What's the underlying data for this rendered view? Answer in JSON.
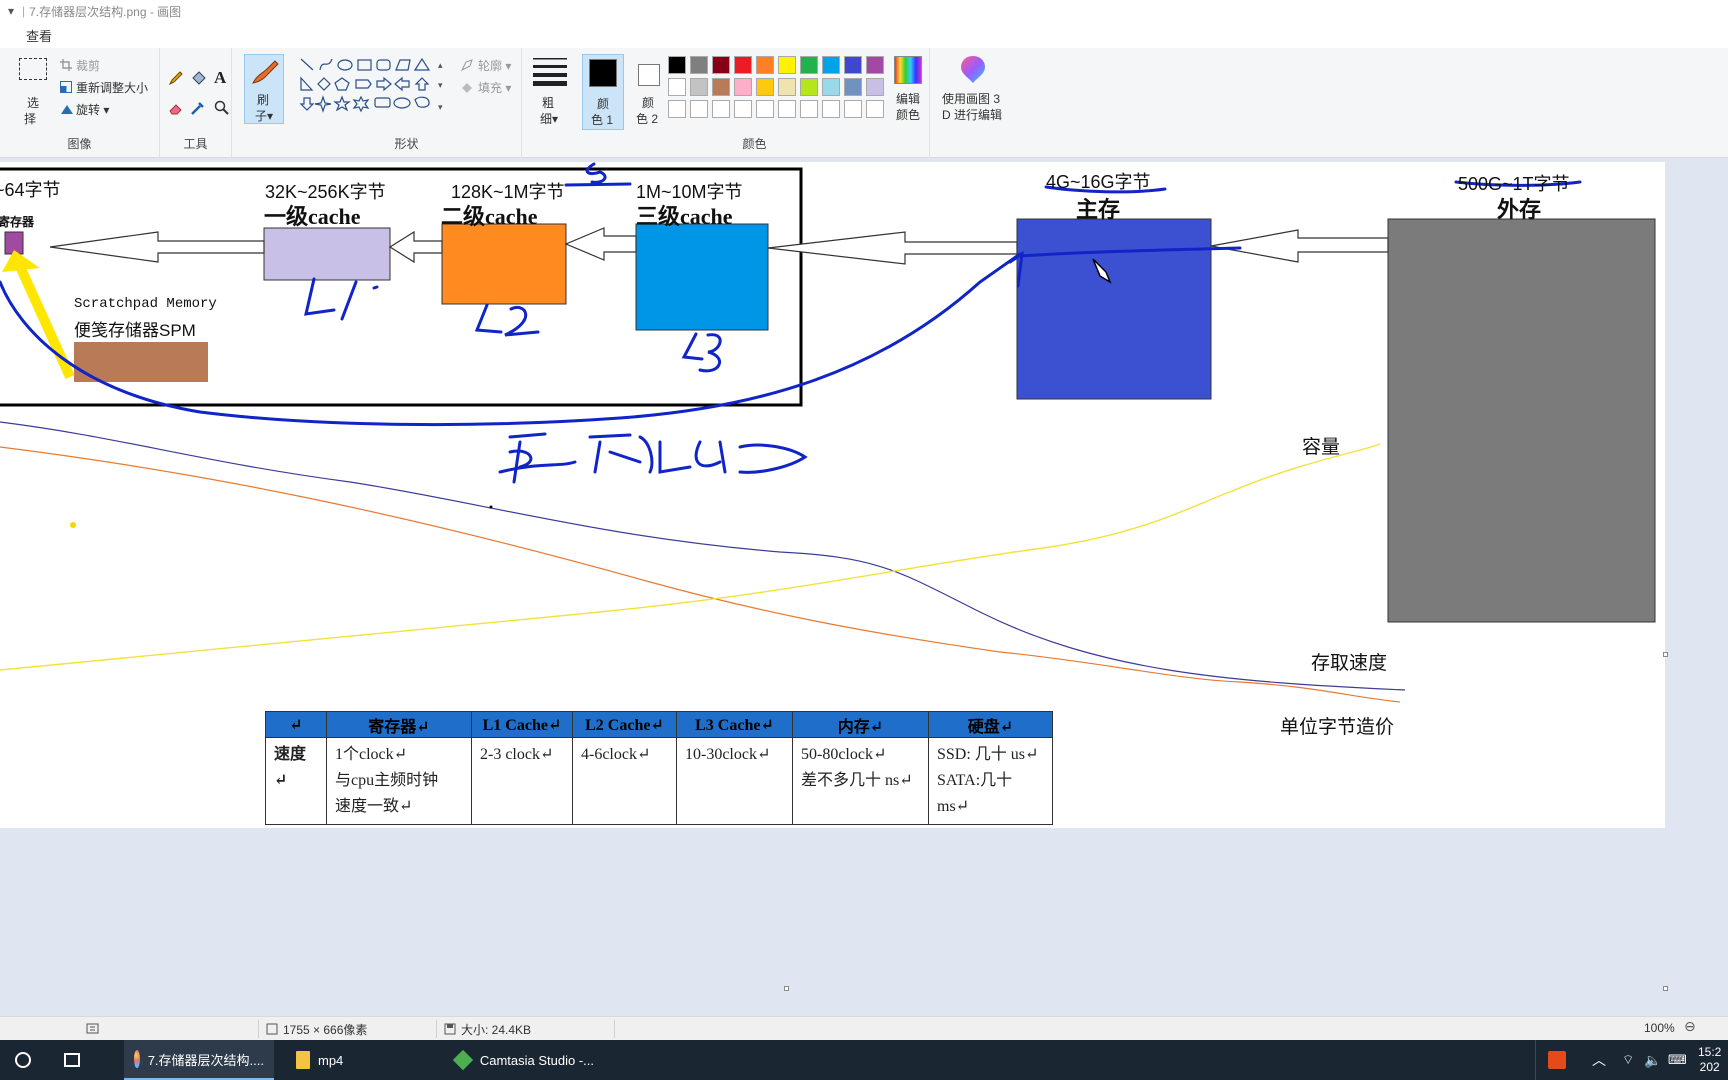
{
  "window": {
    "title": "7.存储器层次结构.png - 画图",
    "quick_access": "▾"
  },
  "menu": {
    "tab_view": "查看"
  },
  "ribbon": {
    "image": {
      "select_label_1": "选",
      "select_label_2": "择",
      "crop": "裁剪",
      "resize": "重新调整大小",
      "rotate": "旋转",
      "group": "图像"
    },
    "tools": {
      "group": "工具"
    },
    "brush": {
      "label_1": "刷",
      "label_2": "子"
    },
    "shapes": {
      "outline": "轮廓",
      "fill": "填充",
      "group": "形状"
    },
    "size": {
      "label_1": "粗",
      "label_2": "细"
    },
    "colors": {
      "color1_label_1": "颜",
      "color1_label_2": "色 1",
      "color2_label_1": "颜",
      "color2_label_2": "色 2",
      "edit_label_1": "编辑",
      "edit_label_2": "颜色",
      "group": "颜色",
      "palette_row1": [
        "#000000",
        "#7f7f7f",
        "#880015",
        "#ed1c24",
        "#ff7f27",
        "#fff200",
        "#22b14c",
        "#00a2e8",
        "#3f48cc",
        "#a349a4"
      ],
      "palette_row2": [
        "#ffffff",
        "#c3c3c3",
        "#b97a57",
        "#ffaec9",
        "#ffc90e",
        "#efe4b0",
        "#b5e61d",
        "#99d9ea",
        "#7092be",
        "#c8bfe7"
      ]
    },
    "paint3d": {
      "label_1": "使用画图 3",
      "label_2": "D 进行编辑"
    }
  },
  "diagram": {
    "reg_bytes": "~64字节",
    "reg_label": "寄存器",
    "l1_bytes": "32K~256K字节",
    "l1_title": "一级cache",
    "l2_bytes": "128K~1M字节",
    "l2_title": "二级cache",
    "l3_bytes": "1M~10M字节",
    "l3_title": "三级cache",
    "main_bytes": "4G~16G字节",
    "main_title": "主存",
    "ext_bytes": "500G~1T字节",
    "ext_title": "外存",
    "spm_en": "Scratchpad Memory",
    "spm_cn": "便笺存储器SPM",
    "capacity": "容量",
    "access_speed": "存取速度",
    "unit_cost": "单位字节造价",
    "colors": {
      "l1": "#c8c0e6",
      "l2": "#ff8a20",
      "l3": "#0096e8",
      "main": "#3c50d2",
      "ext": "#7b7b7b",
      "reg": "#a04aa2",
      "spm": "#b97a57",
      "ink": "#1024c8"
    }
  },
  "table": {
    "headers": [
      "↵",
      "寄存器↵",
      "L1 Cache↵",
      "L2 Cache↵",
      "L3 Cache↵",
      "内存↵",
      "硬盘↵"
    ],
    "row_head": "速度↵",
    "reg_1": "1个clock↵",
    "reg_2": "与cpu主频时钟",
    "reg_3": "速度一致↵",
    "l1": "2-3 clock↵",
    "l2": "4-6clock↵",
    "l3": "10-30clock↵",
    "mem_1": "50-80clock↵",
    "mem_2": "差不多几十 ns↵",
    "disk_1": "SSD: 几十 us↵",
    "disk_2": "SATA:几十 ms↵"
  },
  "status": {
    "dimensions": "1755 × 666像素",
    "size": "大小: 24.4KB",
    "zoom": "100%"
  },
  "taskbar": {
    "paint": "7.存储器层次结构....",
    "folder": "mp4",
    "camtasia": "Camtasia Studio -...",
    "clock_1": "15:2",
    "clock_2": "202"
  }
}
